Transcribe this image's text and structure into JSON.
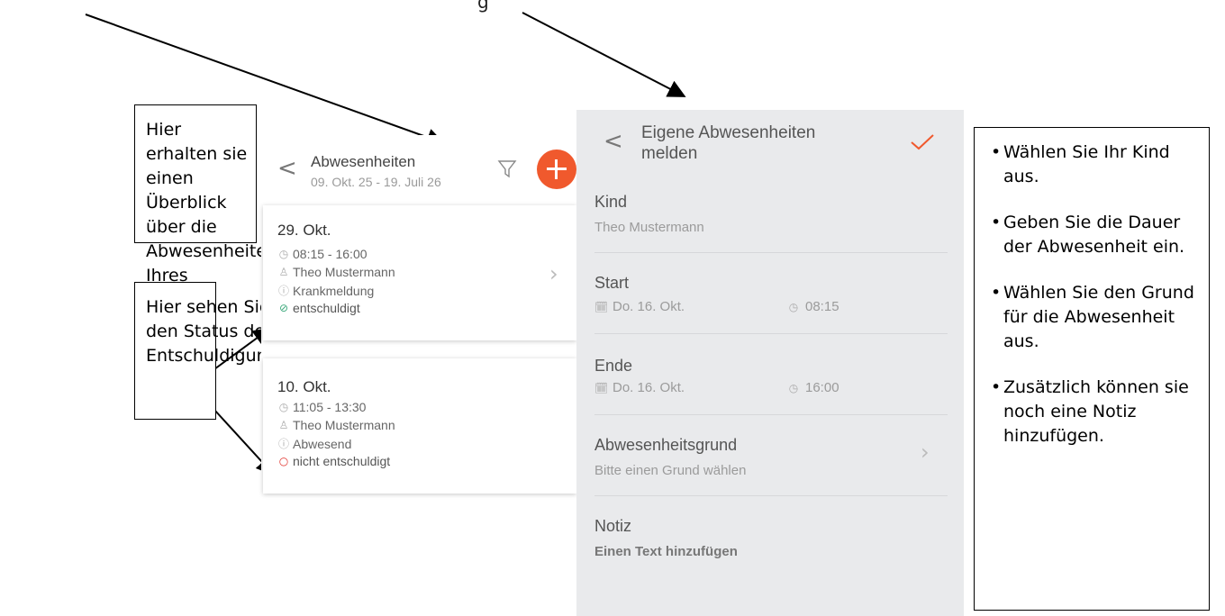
{
  "top_fragment": "g",
  "callouts": {
    "overview": "Hier erhalten sie einen Überblick über die Abwesenheiten Ihres Kindes.",
    "status": "Hier sehen Sie den Status der Entschuldigung.",
    "steps": [
      "Wählen Sie Ihr Kind aus.",
      "Geben Sie die Dauer der Abwesenheit ein.",
      "Wählen Sie den Grund für die Abwesenheit aus.",
      "Zusätzlich können sie noch eine Notiz hinzufügen."
    ]
  },
  "absences_screen": {
    "back": "<",
    "title": "Abwesenheiten",
    "range": "09. Okt. 25 - 19. Juli 26",
    "filter_icon": "filter-icon",
    "add_icon": "plus-icon",
    "accent": "#f0592d",
    "cards": [
      {
        "date": "29. Okt.",
        "time": "08:15 - 16:00",
        "child": "Theo Mustermann",
        "reason": "Krankmeldung",
        "status": "entschuldigt",
        "status_color": "#3aa87a"
      },
      {
        "date": "10. Okt.",
        "time": "11:05 - 13:30",
        "child": "Theo Mustermann",
        "reason": "Abwesend",
        "status": "nicht entschuldigt",
        "status_color": "#e0312b"
      }
    ]
  },
  "report_screen": {
    "back": "<",
    "title_line1": "Eigene Abwesenheiten",
    "title_line2": "melden",
    "confirm_icon": "checkmark-icon",
    "kind_label": "Kind",
    "kind_value": "Theo Mustermann",
    "start_label": "Start",
    "start_date": "Do. 16. Okt.",
    "start_time": "08:15",
    "end_label": "Ende",
    "end_date": "Do. 16. Okt.",
    "end_time": "16:00",
    "reason_label": "Abwesenheitsgrund",
    "reason_placeholder": "Bitte einen Grund wählen",
    "note_label": "Notiz",
    "note_placeholder": "Einen Text hinzufügen"
  }
}
